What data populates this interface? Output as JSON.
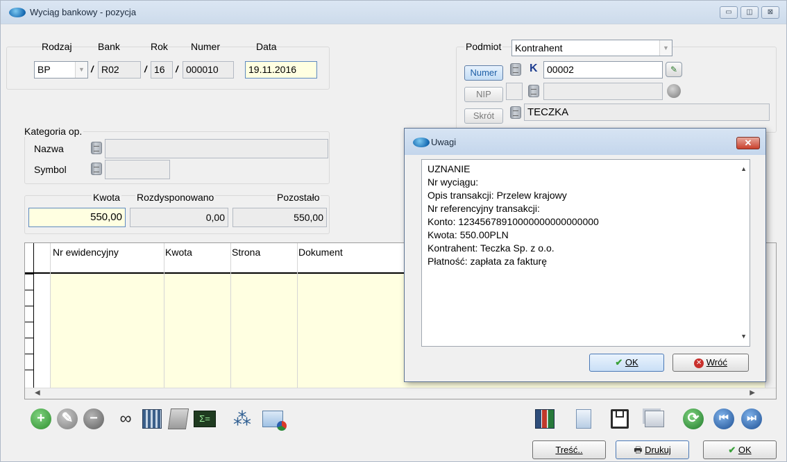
{
  "window": {
    "title": "Wyciąg bankowy - pozycja",
    "buttons": [
      "▭",
      "◫",
      "⊠"
    ]
  },
  "doc": {
    "labels": {
      "rodzaj": "Rodzaj",
      "bank": "Bank",
      "rok": "Rok",
      "numer": "Numer",
      "data": "Data"
    },
    "rodzaj": "BP",
    "bank": "R02",
    "rok": "16",
    "numer": "000010",
    "data": "19.11.2016",
    "slash": "/"
  },
  "podmiot": {
    "label": "Podmiot",
    "type": "Kontrahent",
    "numer_btn": "Numer",
    "nip_btn": "NIP",
    "skrot_btn": "Skrót",
    "k_mark": "K",
    "numer_value": "00002",
    "nip_value": "",
    "skrot_value": "TECZKA"
  },
  "kategoria": {
    "title": "Kategoria op.",
    "nazwa_label": "Nazwa",
    "symbol_label": "Symbol",
    "nazwa_value": "",
    "symbol_value": ""
  },
  "amounts": {
    "kwota_label": "Kwota",
    "rozdysponowano_label": "Rozdysponowano",
    "pozostalo_label": "Pozostało",
    "kwota": "550,00",
    "rozdysponowano": "0,00",
    "pozostalo": "550,00"
  },
  "grid": {
    "columns": [
      "Nr ewidencyjny",
      "Kwota",
      "Strona",
      "Dokument"
    ]
  },
  "bottom_buttons": {
    "tresc": "Treść..",
    "drukuj": "Drukuj",
    "ok": "OK"
  },
  "dialog": {
    "title": "Uwagi",
    "close": "✕",
    "lines": [
      "UZNANIE",
      "Nr wyciągu:",
      "Opis transakcji: Przelew krajowy",
      "Nr referencyjny transakcji:",
      "Konto: 12345678910000000000000000",
      "Kwota: 550.00PLN",
      "Kontrahent: Teczka Sp. z o.o.",
      "Płatność: zapłata za fakturę"
    ],
    "ok": "OK",
    "wroc": "Wróć"
  },
  "colors": {
    "title_bg": "#cddbeb",
    "yellow_cell": "#ffffe1",
    "accent_blue": "#1d5fa6",
    "green": "#3aa13a",
    "red_close": "#c9402c"
  }
}
